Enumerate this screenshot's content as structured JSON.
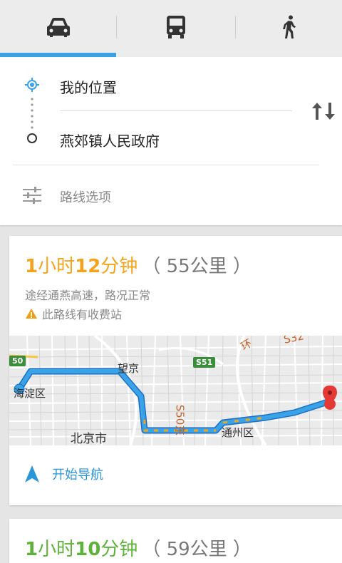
{
  "tabs": [
    {
      "name": "car",
      "icon": "car-icon",
      "selected": true
    },
    {
      "name": "transit",
      "icon": "bus-icon",
      "selected": false
    },
    {
      "name": "walk",
      "icon": "walk-icon",
      "selected": false
    }
  ],
  "route": {
    "origin": "我的位置",
    "destination": "燕郊镇人民政府",
    "options_label": "路线选项"
  },
  "results": [
    {
      "duration_hours": "1",
      "duration_hours_unit": "小时",
      "duration_minutes": "12",
      "duration_minutes_unit": "分钟",
      "distance": "（ 55公里 ）",
      "color": "#f5a31a",
      "via": "途经通燕高速，路况正常",
      "toll_notice": "此路线有收费站",
      "start_nav_label": "开始导航",
      "map_labels": {
        "haidian": "海淀区",
        "wangjing": "望京",
        "beijing": "北京市",
        "tongzhou": "通州区",
        "s50": "S50东",
        "s51": "S51",
        "s32": "S32",
        "huan": "环",
        "fifty": "50"
      }
    },
    {
      "duration_hours": "1",
      "duration_hours_unit": "小时",
      "duration_minutes": "10",
      "duration_minutes_unit": "分钟",
      "distance": "（ 59公里 ）",
      "color": "#5db33a"
    }
  ],
  "colors": {
    "accent_blue": "#3aa3e8",
    "warning": "#f39c12",
    "route_line": "#3aa3e8"
  }
}
